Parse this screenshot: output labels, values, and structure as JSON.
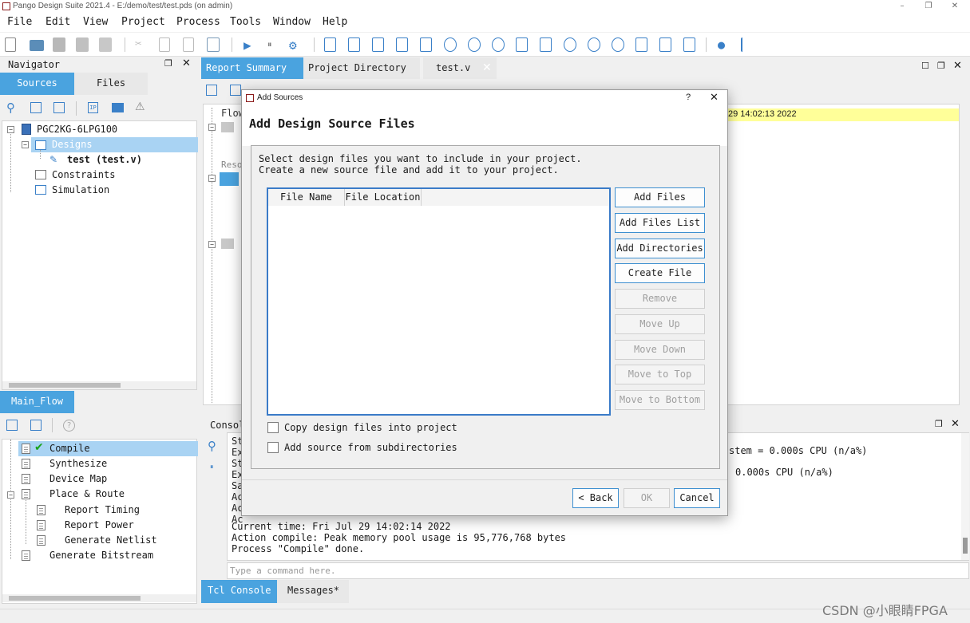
{
  "window": {
    "title": "Pango Design Suite 2021.4 - E:/demo/test/test.pds (on admin)",
    "min_icon": "minimize-icon",
    "restore_icon": "restore-icon",
    "close_icon": "close-icon"
  },
  "menu": [
    "File",
    "Edit",
    "View",
    "Project",
    "Process",
    "Tools",
    "Window",
    "Help"
  ],
  "navigator": {
    "title": "Navigator",
    "tabs": [
      "Sources",
      "Files"
    ],
    "tree": {
      "root": "PGC2KG-6LPG100",
      "designs": "Designs",
      "file": "test (test.v)",
      "constraints": "Constraints",
      "simulation": "Simulation"
    }
  },
  "flow": {
    "tab": "Main_Flow",
    "items": {
      "compile": "Compile",
      "synthesize": "Synthesize",
      "device_map": "Device Map",
      "place_route": "Place & Route",
      "report_timing": "Report Timing",
      "report_power": "Report Power",
      "generate_netlist": "Generate Netlist",
      "generate_bitstream": "Generate Bitstream"
    }
  },
  "editor": {
    "tabs": [
      "Report Summary",
      "Project Directory",
      "test.v"
    ],
    "summary_tree": [
      "Flow",
      "Reso"
    ],
    "highlight_text": "29 14:02:13 2022"
  },
  "console": {
    "title": "Consol",
    "right_lines": [
      "stem = 0.000s CPU (n/a%)",
      "0.000s CPU (n/a%)"
    ],
    "left_stub": [
      "St",
      "Ex",
      "St",
      "Ex",
      "Sa",
      "Ac",
      "Ac",
      "Ac"
    ],
    "lines": [
      "Current time: Fri Jul 29 14:02:14 2022",
      "Action compile: Peak memory pool usage is 95,776,768 bytes",
      "Process \"Compile\" done."
    ],
    "input_placeholder": "Type a command here.",
    "tabs": [
      "Tcl Console",
      "Messages*"
    ]
  },
  "dialog": {
    "title": "Add Sources",
    "help": "?",
    "heading": "Add Design Source Files",
    "desc_line1": "Select design files you want to include in your project.",
    "desc_line2": "Create a new source file and add it to your project.",
    "columns": [
      "File Name",
      "File Location"
    ],
    "buttons": {
      "add_files": "Add Files",
      "add_files_list": "Add Files List",
      "add_directories": "Add Directories",
      "create_file": "Create File",
      "remove": "Remove",
      "move_up": "Move Up",
      "move_down": "Move Down",
      "move_top": "Move to Top",
      "move_bottom": "Move to Bottom"
    },
    "check_copy": "Copy design files into project",
    "check_subdirs": "Add source from subdirectories",
    "back": "< Back",
    "ok": "OK",
    "cancel": "Cancel"
  },
  "watermark": "CSDN @小眼睛FPGA",
  "colors": {
    "accent": "#4aa3df",
    "highlight": "#ffff99",
    "check_green": "#1aa31a"
  }
}
